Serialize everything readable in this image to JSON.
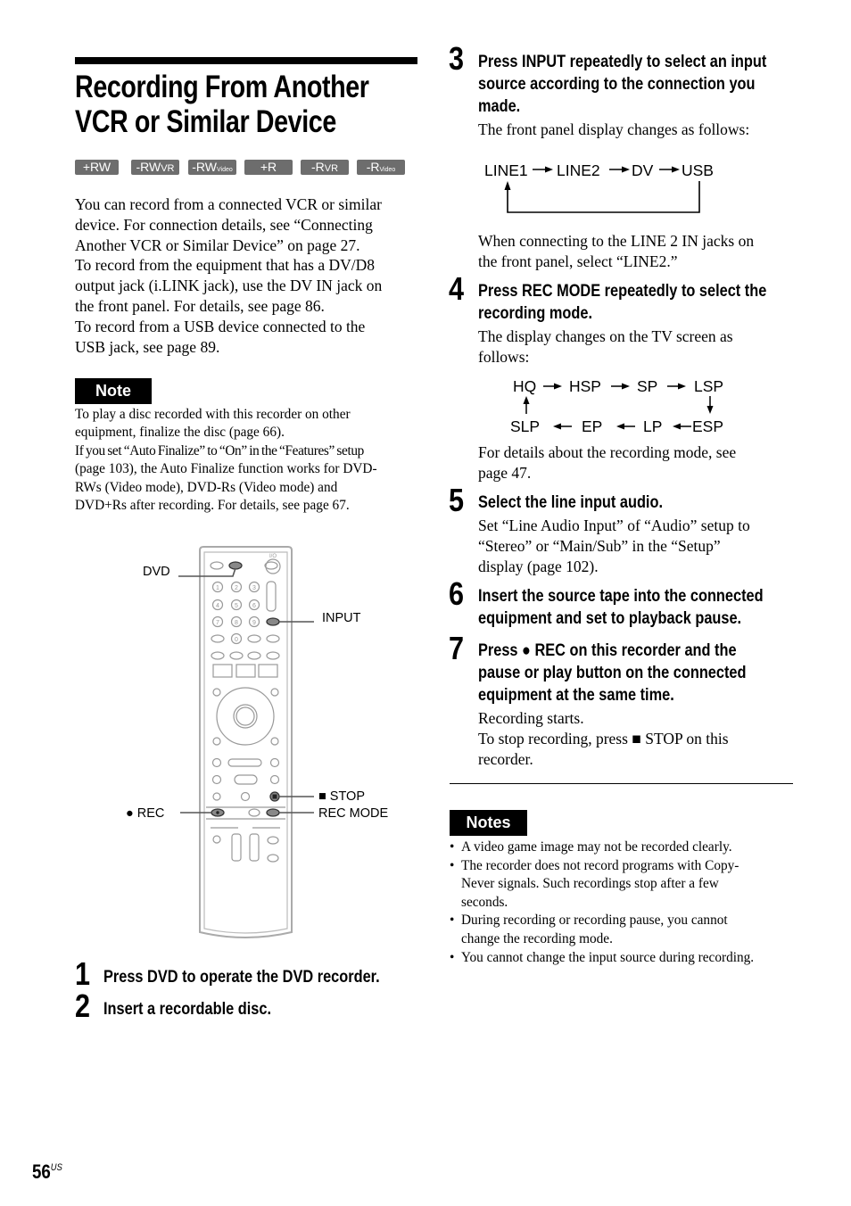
{
  "page": {
    "title_line1": "Recording From Another",
    "title_line2": "VCR or Similar Device",
    "page_number": "56",
    "page_suffix": "US"
  },
  "disc_badges": [
    {
      "main": "+RW",
      "sub": ""
    },
    {
      "main": "-RW",
      "sub": "VR"
    },
    {
      "main": "-RW",
      "sub": "Video"
    },
    {
      "main": "+R",
      "sub": ""
    },
    {
      "main": "-R",
      "sub": "VR"
    },
    {
      "main": "-R",
      "sub": "Video"
    }
  ],
  "intro": [
    "You can record from a connected VCR or similar",
    "device. For connection details, see “Connecting",
    "Another VCR or Similar Device” on page 27.",
    "To record from the equipment that has a DV/D8",
    "output jack (i.LINK jack), use the DV IN jack on",
    "the front panel. For details, see page 86.",
    "To record from a USB device connected to the",
    "USB jack, see page 89."
  ],
  "note": {
    "label": "Note",
    "lines": [
      "To play a disc recorded with this recorder on other",
      "equipment, finalize the disc (page 66).",
      "If you set “Auto Finalize” to “On” in the “Features” setup",
      "(page 103), the Auto Finalize function works for DVD-",
      "RWs (Video mode), DVD-Rs (Video mode) and",
      "DVD+Rs after recording. For details, see page 67."
    ]
  },
  "remote": {
    "labels": {
      "dvd": "DVD",
      "input": "INPUT",
      "stop": "■ STOP",
      "rec": "● REC",
      "rec_mode": "REC MODE"
    },
    "number_keys": [
      "1",
      "2",
      "3",
      "4",
      "5",
      "6",
      "7",
      "8",
      "9",
      "0"
    ],
    "power_label": "I/⏻",
    "tv_power_label": "I/⏻"
  },
  "steps": [
    {
      "num": "1",
      "head": [
        "Press DVD to operate the DVD recorder."
      ],
      "body": []
    },
    {
      "num": "2",
      "head": [
        "Insert a recordable disc."
      ],
      "body": []
    },
    {
      "num": "3",
      "head": [
        "Press INPUT repeatedly to select an input",
        "source according to the connection you",
        "made."
      ],
      "body": [
        "The front panel display changes as follows:"
      ],
      "after": [
        "When connecting to the LINE 2 IN jacks on",
        "the front panel, select “LINE2.”"
      ]
    },
    {
      "num": "4",
      "head": [
        "Press REC MODE repeatedly to select the",
        "recording mode."
      ],
      "body": [
        "The display changes on the TV screen as",
        "follows:"
      ],
      "after": [
        "For details about the recording mode, see",
        "page 47."
      ]
    },
    {
      "num": "5",
      "head": [
        "Select the line input audio."
      ],
      "body": [
        "Set “Line Audio Input” of “Audio” setup to",
        "“Stereo” or “Main/Sub” in the “Setup”",
        "display (page 102)."
      ]
    },
    {
      "num": "6",
      "head": [
        "Insert the source tape into the connected",
        "equipment and set to playback pause."
      ],
      "body": []
    },
    {
      "num": "7",
      "head": [
        "Press ● REC on this recorder and the",
        "pause or play button on the connected",
        "equipment at the same time."
      ],
      "body": [
        "Recording starts.",
        "To stop recording, press ■ STOP on this",
        "recorder."
      ]
    }
  ],
  "input_flow": [
    "LINE1",
    "LINE2",
    "DV",
    "USB"
  ],
  "rec_mode_flow": {
    "top": [
      "HQ",
      "HSP",
      "SP",
      "LSP"
    ],
    "bottom": [
      "SLP",
      "EP",
      "LP",
      "ESP"
    ]
  },
  "notes": {
    "label": "Notes",
    "items": [
      [
        "A video game image may not be recorded clearly."
      ],
      [
        "The recorder does not record programs with Copy-",
        "Never signals. Such recordings stop after a few",
        "seconds."
      ],
      [
        "During recording or recording pause, you cannot",
        "change the recording mode."
      ],
      [
        "You cannot change the input source during recording."
      ]
    ]
  }
}
